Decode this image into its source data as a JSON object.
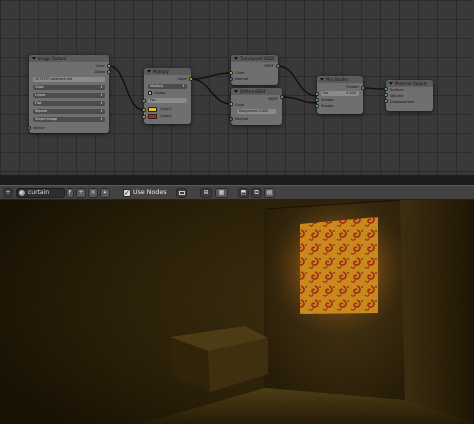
{
  "node_editor": {
    "nodes": {
      "image_texture": {
        "title": "Image Texture",
        "out_color": "Color",
        "out_alpha": "Alpha",
        "image": "1575727-abstract-red",
        "color_mode": "Color",
        "interpolation": "Linear",
        "projection": "Flat",
        "extension": "Repeat",
        "source": "Single Image",
        "in_vector": "Vector"
      },
      "multiply": {
        "title": "Multiply",
        "out_color": "Color",
        "blend": "Multiply",
        "clamp_label": "Clamp",
        "fac": "Fac",
        "in_color1": "Color1",
        "in_color2": "Color2"
      },
      "translucent": {
        "title": "Translucent BSDF",
        "out_bsdf": "BSDF",
        "in_color": "Color",
        "in_normal": "Normal"
      },
      "diffuse": {
        "title": "Diffuse BSDF",
        "out_bsdf": "BSDF",
        "in_color": "Color",
        "roughness": "Roughness 0.000",
        "in_normal": "Normal"
      },
      "mix_shader": {
        "title": "Mix Shader",
        "out_shader": "Shader",
        "fac": "Fac",
        "fac_value": "0.500",
        "in_shader1": "Shader",
        "in_shader2": "Shader"
      },
      "material_output": {
        "title": "Material Output",
        "surface": "Surface",
        "volume": "Volume",
        "displacement": "Displacement"
      }
    }
  },
  "toolbar": {
    "material_name": "curtain",
    "material_id": "F",
    "use_nodes_checked": true,
    "use_nodes_label": "Use Nodes"
  },
  "icons": [
    "node-editor-icon",
    "view-menu-icon",
    "object-icon",
    "world-icon",
    "material-sphere-icon",
    "fake-user-icon",
    "add-icon",
    "close-icon",
    "backdrop-icon",
    "snap-icon",
    "parent-icon",
    "copy-icon",
    "paste-icon"
  ],
  "colors": {
    "shader_socket": "#63c763",
    "color_socket": "#c7c729",
    "float_socket": "#a1a1a1",
    "vector_socket": "#6363c7",
    "color1_swatch": "#e8c21e",
    "color2_swatch": "#cc1a1a",
    "curtain_glow": "#f2a21c"
  }
}
